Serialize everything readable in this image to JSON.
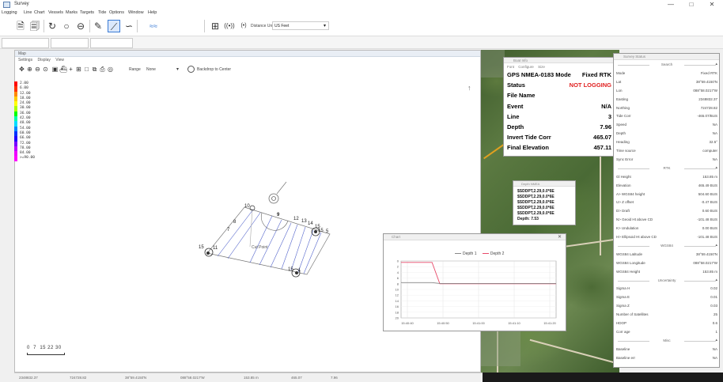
{
  "window": {
    "title": "Survey",
    "minimize": "—",
    "maximize": "□",
    "close": "✕"
  },
  "menu": [
    "Logging",
    "Line",
    "Chart",
    "Vessels",
    "Marks",
    "Targets",
    "Tide",
    "Options",
    "Window",
    "Help"
  ],
  "toolbar": {
    "icons": [
      "document-icon",
      "document-list-icon",
      "circle-arrow-icon",
      "circle-icon",
      "circle-minus-icon",
      "pencil-line-icon",
      "line-tool-icon",
      "curve-tool-icon",
      "waveform-icon",
      "grid-target-icon",
      "broadcast-icon",
      "broadcast-small-icon"
    ],
    "distance_unit_label": "Distance Unit",
    "distance_unit_value": "US Feet"
  },
  "map": {
    "title": "Map",
    "menu": [
      "Settings",
      "Display",
      "View"
    ],
    "range_label": "Range",
    "range_value": "None",
    "center_label": "Backdrop to Center",
    "legend": [
      {
        "label": "2.00",
        "color": "#ff0000"
      },
      {
        "label": "6.00",
        "color": "#ff3300"
      },
      {
        "label": "12.00",
        "color": "#ff8800"
      },
      {
        "label": "18.00",
        "color": "#ffcc00"
      },
      {
        "label": "24.00",
        "color": "#ffff00"
      },
      {
        "label": "30.00",
        "color": "#aaff00"
      },
      {
        "label": "36.00",
        "color": "#00ff00"
      },
      {
        "label": "42.00",
        "color": "#00ffaa"
      },
      {
        "label": "48.00",
        "color": "#00ddff"
      },
      {
        "label": "54.00",
        "color": "#0088ff"
      },
      {
        "label": "60.00",
        "color": "#0033ff"
      },
      {
        "label": "66.00",
        "color": "#2200ff"
      },
      {
        "label": "72.00",
        "color": "#7700ff"
      },
      {
        "label": "78.00",
        "color": "#bb00ff"
      },
      {
        "label": "84.00",
        "color": "#ee00ff"
      },
      {
        "label": ">=90.00",
        "color": "#ff00ff"
      }
    ],
    "line_labels": {
      "top": "10",
      "l8": "8",
      "l9": "9",
      "l7": "7",
      "l12": "12",
      "l13": "13",
      "l14": "14",
      "l15": "15",
      "tr": "15",
      "trb": "5",
      "left": "15",
      "leftb": "11",
      "bottom": "15",
      "bottomb": "1",
      "cut": "Cut Point"
    },
    "scale_numbers": "0  7  15 22 30"
  },
  "gps": {
    "title": "Boat Info",
    "menu": [
      "Font",
      "Configure",
      "Size"
    ],
    "rows": [
      {
        "k": "GPS NMEA-0183 Mode",
        "v": "Fixed RTK",
        "red": false
      },
      {
        "k": "Status",
        "v": "NOT LOGGING",
        "red": true
      },
      {
        "k": "File Name",
        "v": "",
        "red": false
      },
      {
        "k": "Event",
        "v": "N/A",
        "red": false
      },
      {
        "k": "Line",
        "v": "3",
        "red": false
      },
      {
        "k": "Depth",
        "v": "7.96",
        "red": false
      },
      {
        "k": "Invert Tide Corr",
        "v": "465.07",
        "red": false
      },
      {
        "k": "Final Elevation",
        "v": "457.11",
        "red": false
      }
    ]
  },
  "nmea": {
    "title": "Depth NMEA",
    "lines": [
      "$SDDPT,2.29,0.0*6E",
      "$SDDPT,2.29,0.0*6E",
      "$SDDPT,2.29,0.0*6E",
      "$SDDPT,2.29,0.0*6E",
      "$SDDPT,2.29,0.0*6E"
    ],
    "depth": "Depth: 7.53"
  },
  "depth_chart": {
    "title": "Chart",
    "close": "✕",
    "legend": [
      {
        "name": "Depth 1",
        "color": "#888888"
      },
      {
        "name": "Depth 2",
        "color": "#e84a6a"
      }
    ],
    "chart_data": {
      "type": "line",
      "x": [
        "15:40:40",
        "15:40:50",
        "15:41:00",
        "15:41:10",
        "15:41:20"
      ],
      "yticks": [
        "0",
        "2",
        "4",
        "6",
        "8",
        "10",
        "12",
        "14",
        "16",
        "18",
        "20"
      ],
      "ylim": [
        0,
        20
      ],
      "series": [
        {
          "name": "Depth 2",
          "points": [
            [
              0,
              0.5
            ],
            [
              0.2,
              0.5
            ],
            [
              0.25,
              8
            ],
            [
              0.5,
              8
            ],
            [
              0.75,
              8
            ],
            [
              1.0,
              8
            ]
          ]
        },
        {
          "name": "Depth 1",
          "points": [
            [
              0,
              7.6
            ],
            [
              0.2,
              7.6
            ],
            [
              0.25,
              7.9
            ],
            [
              0.5,
              7.9
            ],
            [
              0.75,
              7.9
            ],
            [
              1.0,
              7.9
            ]
          ]
        }
      ]
    }
  },
  "status_panel": {
    "title": "Survey Status",
    "rows": [
      {
        "type": "sec",
        "k": "Search"
      },
      {
        "k": "Mode",
        "v": "Fixed RTK"
      },
      {
        "k": "Lat",
        "v": "38°59.4150'N"
      },
      {
        "k": "Lon",
        "v": "088°58.0217'W"
      },
      {
        "k": "Easting",
        "v": "2348832.37"
      },
      {
        "k": "Northing",
        "v": "724728.82"
      },
      {
        "k": "Tide Corr",
        "v": "-465.07/BUS"
      },
      {
        "k": "Speed",
        "v": "NA"
      },
      {
        "k": "Depth",
        "v": "NA"
      },
      {
        "k": "Heading",
        "v": "32.5°"
      },
      {
        "k": "Time source",
        "v": "computer"
      },
      {
        "k": "Sync Error",
        "v": "NA"
      },
      {
        "type": "sec",
        "k": "RTK"
      },
      {
        "k": "Gl Height",
        "v": "153.85 m"
      },
      {
        "k": "Elevation",
        "v": "465.49 BUS"
      },
      {
        "k": "A> WGS84 height",
        "v": "504.60 BUS"
      },
      {
        "k": "U> Z offset",
        "v": "-0.47 BUS"
      },
      {
        "k": "D> Draft",
        "v": "0.60 BUS"
      },
      {
        "k": "N> Geoid Ht above CD",
        "v": "-101.48 BUS"
      },
      {
        "k": "K> Undulation",
        "v": "0.00 BUS"
      },
      {
        "k": "H> Ellipsoid Ht above CD",
        "v": "-101.48 BUS"
      },
      {
        "type": "sec",
        "k": "WGS84"
      },
      {
        "k": "WGS84 Latitude",
        "v": "38°59.4150'N"
      },
      {
        "k": "WGS84 Longitude",
        "v": "088°58.0217'W"
      },
      {
        "k": "WGS84 Height",
        "v": "153.85 m"
      },
      {
        "type": "sec",
        "k": "Uncertainty"
      },
      {
        "k": "Sigma H",
        "v": "0.02"
      },
      {
        "k": "Sigma E",
        "v": "0.01"
      },
      {
        "k": "Sigma Z",
        "v": "0.03"
      },
      {
        "k": "Number of Satellites",
        "v": "25"
      },
      {
        "k": "HDOP",
        "v": "0.6"
      },
      {
        "k": "Corr age",
        "v": "1"
      },
      {
        "type": "sec",
        "k": "Misc"
      },
      {
        "k": "Baseline",
        "v": "NA"
      },
      {
        "k": "Baseline err",
        "v": "NA"
      }
    ]
  },
  "statusbar": [
    "2348832.37",
    "724728.82",
    "38°59.4150'N",
    "088°58.0217'W",
    "153.85 m",
    "465.07",
    "7.96"
  ]
}
